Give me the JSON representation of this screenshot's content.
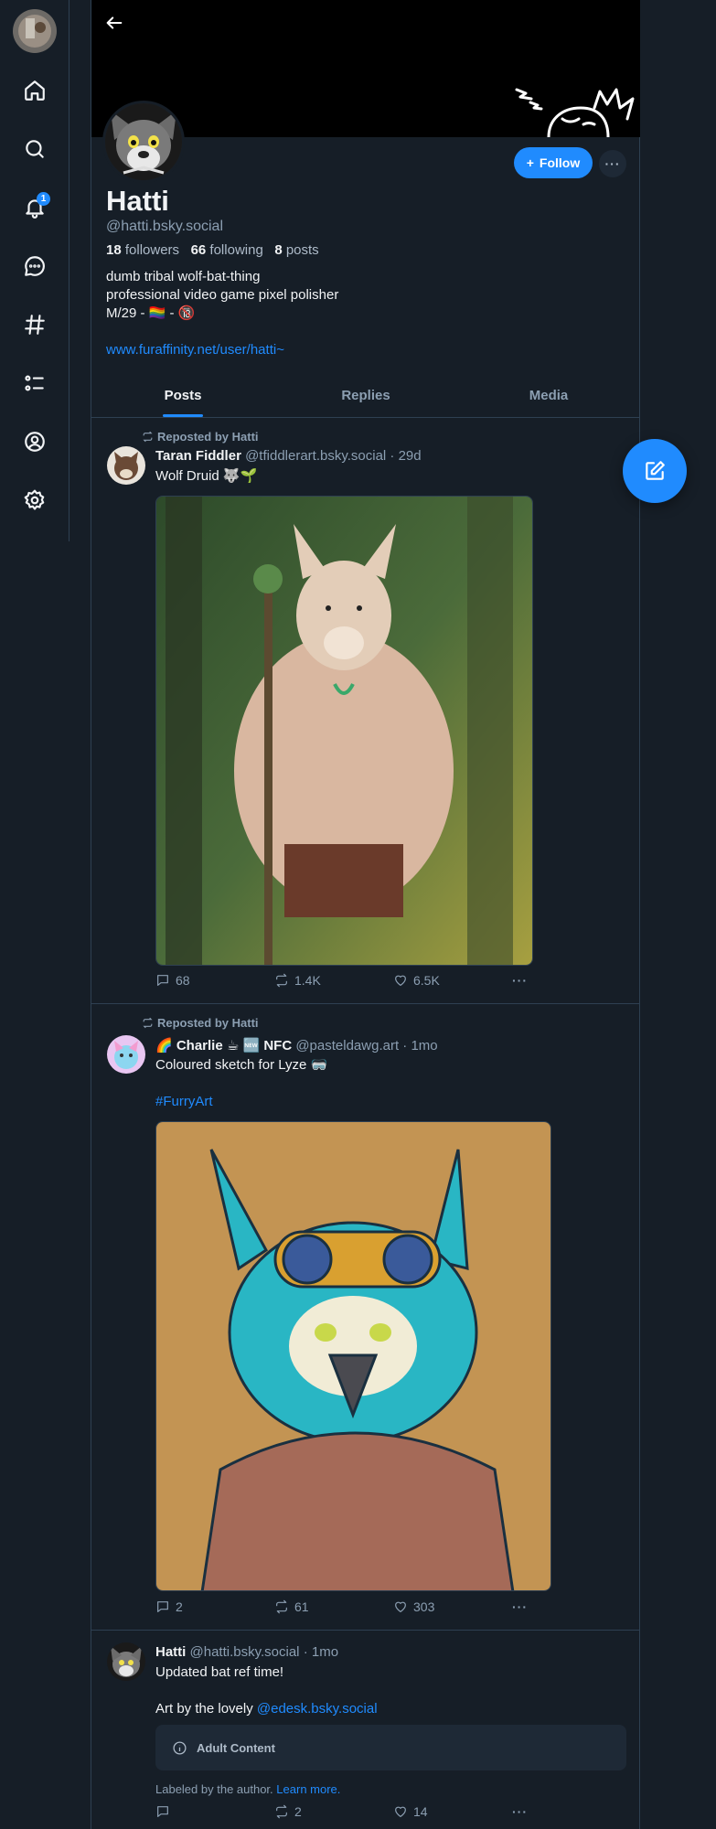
{
  "nav": {
    "notification_count": "1"
  },
  "profile": {
    "display_name": "Hatti",
    "handle": "@hatti.bsky.social",
    "followers_count": "18",
    "followers_label": "followers",
    "following_count": "66",
    "following_label": "following",
    "posts_count": "8",
    "posts_label": "posts",
    "bio_lines": [
      "dumb tribal wolf-bat-thing",
      "professional video game pixel polisher",
      "M/29 - 🏳️‍🌈 - 🔞"
    ],
    "link": "www.furaffinity.net/user/hatti~",
    "follow_label": "Follow",
    "more_label": "···"
  },
  "tabs": [
    {
      "label": "Posts",
      "active": true
    },
    {
      "label": "Replies",
      "active": false
    },
    {
      "label": "Media",
      "active": false
    }
  ],
  "posts": [
    {
      "repost_label": "Reposted by Hatti",
      "author_name": "Taran Fiddler",
      "author_handle": "@tfiddlerart.bsky.social",
      "time": "· 29d",
      "text": "Wolf Druid 🐺🌱",
      "hashtag": "",
      "replies": "68",
      "reposts": "1.4K",
      "likes": "6.5K",
      "more": "···"
    },
    {
      "repost_label": "Reposted by Hatti",
      "author_name": "🌈 Charlie ☕ 🆕 NFC",
      "author_handle": "@pasteldawg.art",
      "time": "· 1mo",
      "text": "Coloured sketch for Lyze 🥽",
      "hashtag": "#FurryArt",
      "replies": "2",
      "reposts": "61",
      "likes": "303",
      "more": "···"
    },
    {
      "repost_label": "",
      "author_name": "Hatti",
      "author_handle": "@hatti.bsky.social",
      "time": "· 1mo",
      "text": "Updated bat ref time!",
      "text2_prefix": "Art by the lovely",
      "text2_mention": "@edesk.bsky.social",
      "warning": "Adult Content",
      "label_note": "Labeled by the author.",
      "learn_more": "Learn more.",
      "replies": "",
      "reposts": "2",
      "likes": "14",
      "more": "···"
    }
  ],
  "colors": {
    "accent": "#208bfe",
    "background": "#161e27",
    "muted": "#8c9fb2",
    "border": "#2e4052"
  }
}
